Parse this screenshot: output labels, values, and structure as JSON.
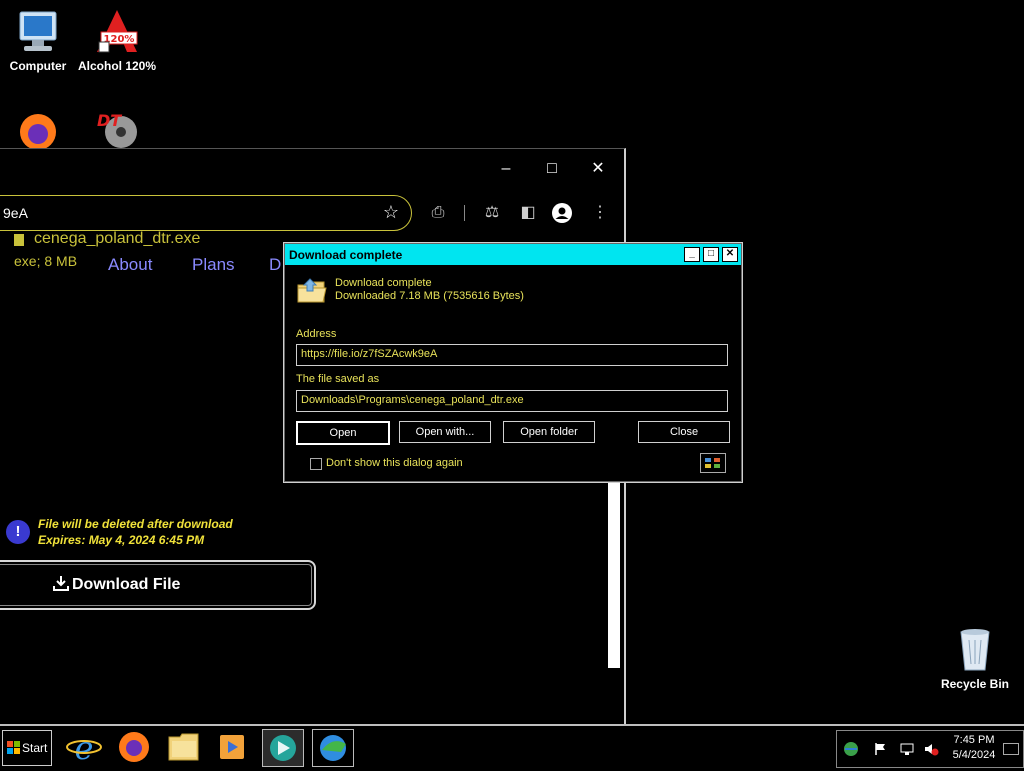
{
  "desktop": {
    "icons": [
      {
        "label": "Computer"
      },
      {
        "label": "Alcohol 120%"
      },
      {
        "label": ""
      },
      {
        "label": ""
      },
      {
        "label": "Recycle Bin"
      }
    ]
  },
  "browser": {
    "url_fragment": "9eA",
    "file_name": "cenega_poland_dtr.exe",
    "file_meta": "exe; 8 MB",
    "nav": [
      "About",
      "Plans",
      "D"
    ],
    "warning_line1": "File will be deleted after download",
    "warning_line2": "Expires: May 4, 2024 6:45 PM",
    "download_button": "Download File"
  },
  "dialog": {
    "title": "Download complete",
    "status": "Download complete",
    "downloaded": "Downloaded 7.18  MB (7535616 Bytes)",
    "address_label": "Address",
    "address_value": "https://file.io/z7fSZAcwk9eA",
    "saved_label": "The file saved as",
    "saved_value": "Downloads\\Programs\\cenega_poland_dtr.exe",
    "buttons": {
      "open": "Open",
      "open_with": "Open with...",
      "open_folder": "Open folder",
      "close": "Close"
    },
    "dont_show": "Don't show this dialog again"
  },
  "taskbar": {
    "start": "Start",
    "time": "7:45 PM",
    "date": "5/4/2024"
  },
  "colors": {
    "accent_yellow": "#e8e25a",
    "dialog_title": "#00e5f0",
    "link_blue": "#8a8aff"
  }
}
